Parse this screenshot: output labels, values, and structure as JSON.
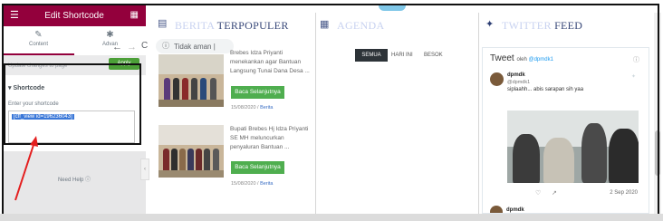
{
  "panel": {
    "title": "Edit Shortcode",
    "menu_icon": "hamburger-icon",
    "grid_icon": "grid-icon",
    "tabs": [
      {
        "label": "Content",
        "icon": "pencil-icon"
      },
      {
        "label": "Advan",
        "icon": "gear-icon"
      }
    ],
    "update_text": "Update changes to page",
    "apply_label": "Apply",
    "section_title": "Shortcode",
    "field_label": "Enter your shortcode",
    "shortcode_value": "[cff_view id=196236043]",
    "need_help": "Need Help",
    "accent_color": "#93003c"
  },
  "browser": {
    "url_text": "Tidak aman | "
  },
  "page": {
    "berita": {
      "title_light": "BERITA",
      "title_dark": "TERPOPULER",
      "items": [
        {
          "text": "Brebes Idza Priyanti menekankan agar Bantuan Langsung Tunai Dana Desa ...",
          "button": "Baca Selanjutnya",
          "date": "15/08/2020 /",
          "category": "Berita"
        },
        {
          "text": "Bupati Brebes Hj Idza Priyanti SE MH meluncurkan penyaluran Bantuan ...",
          "button": "Baca Selanjutnya",
          "date": "15/08/2020 /",
          "category": "Berita"
        }
      ]
    },
    "agenda": {
      "title": "AGENDA",
      "tabs": [
        "SEMUA",
        "HARI INI",
        "BESOK"
      ]
    },
    "twitter": {
      "title_light": "TWITTER",
      "title_dark": "FEED",
      "widget_title": "Tweet",
      "by_text": "oleh",
      "by_handle": "@dpmdk1",
      "user_name": "dpmdk",
      "user_handle": "@dpmdk1",
      "tweet_text": "siplaahh... abis sarapan sih yaa",
      "tweet_date": "2 Sep 2020",
      "next_user": "dpmdk"
    }
  }
}
